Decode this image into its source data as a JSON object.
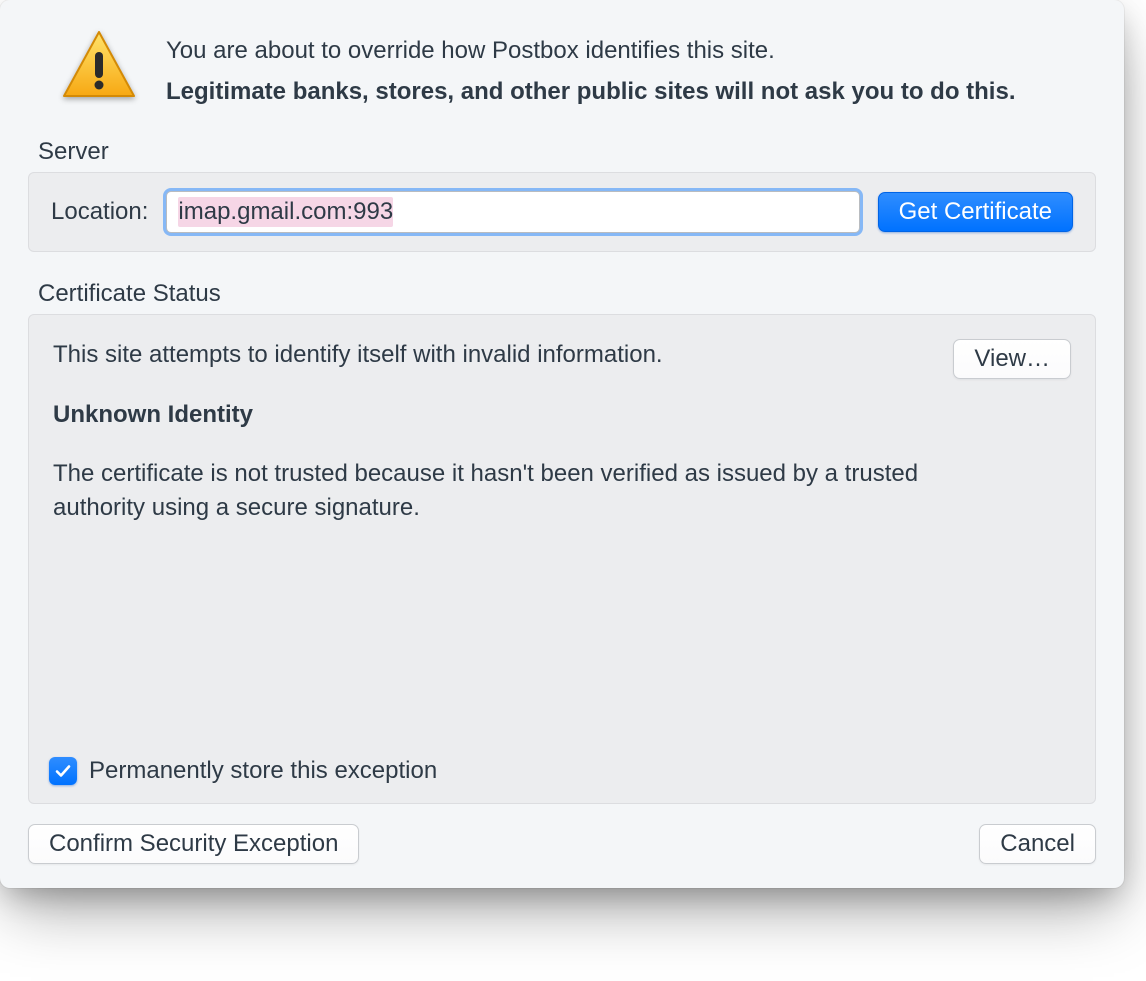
{
  "header": {
    "line1": "You are about to override how Postbox identifies this site.",
    "line2": "Legitimate banks, stores, and other public sites will not ask you to do this."
  },
  "server": {
    "section_label": "Server",
    "location_label": "Location:",
    "location_value": "imap.gmail.com:993",
    "get_certificate_label": "Get Certificate"
  },
  "cert": {
    "section_label": "Certificate Status",
    "message": "This site attempts to identify itself with invalid information.",
    "view_label": "View…",
    "unknown_title": "Unknown Identity",
    "explanation": "The certificate is not trusted because it hasn't been verified as issued by a trusted authority using a secure signature.",
    "permanent_label": "Permanently store this exception",
    "permanent_checked": true
  },
  "footer": {
    "confirm_label": "Confirm Security Exception",
    "cancel_label": "Cancel"
  }
}
